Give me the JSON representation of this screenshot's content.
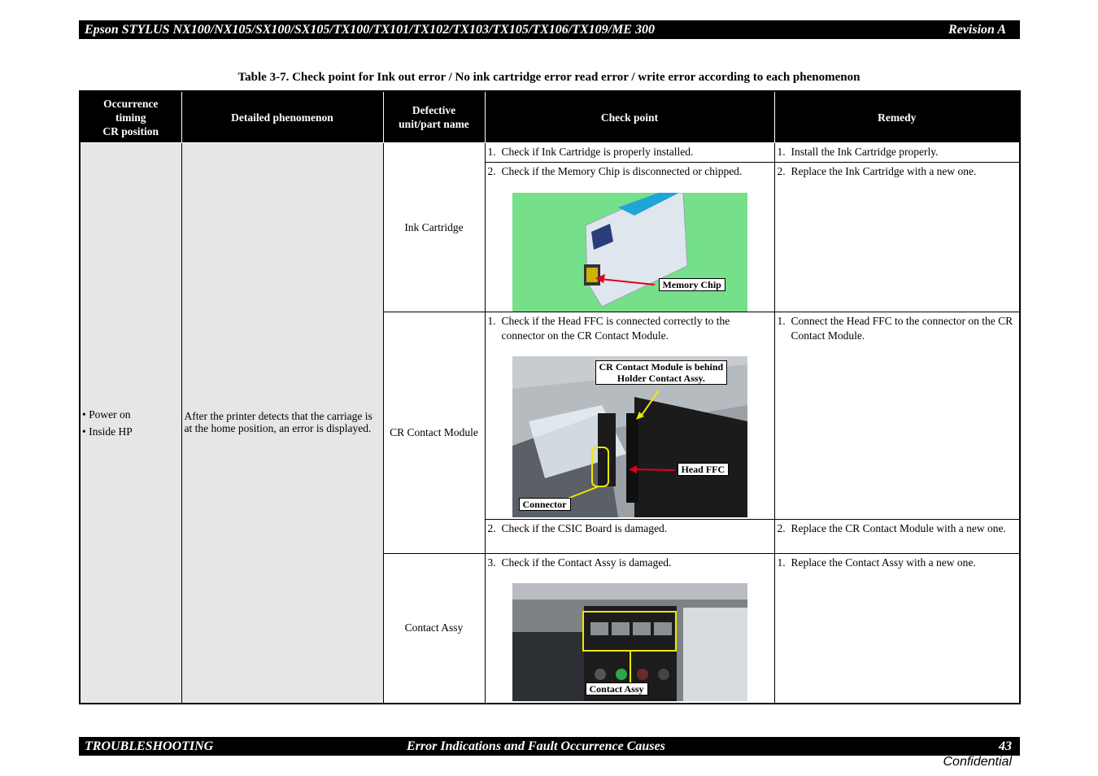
{
  "header": {
    "title": "Epson STYLUS NX100/NX105/SX100/SX105/TX100/TX101/TX102/TX103/TX105/TX106/TX109/ME 300",
    "revision": "Revision A"
  },
  "caption": "Table 3-7.  Check point for Ink out error / No ink cartridge error read error / write error according to each phenomenon",
  "columns": {
    "occurrence": [
      "Occurrence",
      "timing",
      "CR position"
    ],
    "detailed": "Detailed phenomenon",
    "defective": [
      "Defective",
      "unit/part name"
    ],
    "check": "Check point",
    "remedy": "Remedy"
  },
  "occurrence_items": [
    "• Power on",
    "• Inside HP"
  ],
  "phenomenon": "After the printer detects that the carriage is at the home position, an error is displayed.",
  "units": {
    "ink": "Ink Cartridge",
    "cr": "CR Contact Module",
    "contact": "Contact Assy"
  },
  "rows": [
    {
      "check_num": "1.",
      "check": "Check if Ink Cartridge is properly installed.",
      "remedy_num": "1.",
      "remedy": "Install the Ink Cartridge properly."
    },
    {
      "check_num": "2.",
      "check": "Check if the Memory Chip is disconnected or chipped.",
      "remedy_num": "2.",
      "remedy": "Replace the Ink Cartridge with a new one."
    },
    {
      "check_num": "1.",
      "check": "Check if the Head FFC is connected correctly to the connector on the CR Contact Module.",
      "remedy_num": "1.",
      "remedy": "Connect the Head FFC to the connector on the CR Contact Module."
    },
    {
      "check_num": "2.",
      "check": "Check if the CSIC Board is damaged.",
      "remedy_num": "2.",
      "remedy": "Replace the CR Contact Module with a new one."
    },
    {
      "check_num": "3.",
      "check": "Check if the Contact Assy is damaged.",
      "remedy_num": "1.",
      "remedy": "Replace the Contact Assy with a new one."
    }
  ],
  "photo_labels": {
    "memory_chip": "Memory Chip",
    "cr_behind": [
      "CR Contact Module is behind",
      "Holder Contact Assy."
    ],
    "head_ffc": "Head FFC",
    "connector": "Connector",
    "contact_assy": "Contact Assy"
  },
  "footer": {
    "section": "TROUBLESHOOTING",
    "title": "Error Indications and Fault Occurrence Causes",
    "page": "43"
  },
  "confidential": "Confidential",
  "colors": {
    "bar": "#000000",
    "photo_green": "#6fdc84",
    "arrow_red": "#e0001b",
    "highlight_yellow": "#f2e600"
  }
}
